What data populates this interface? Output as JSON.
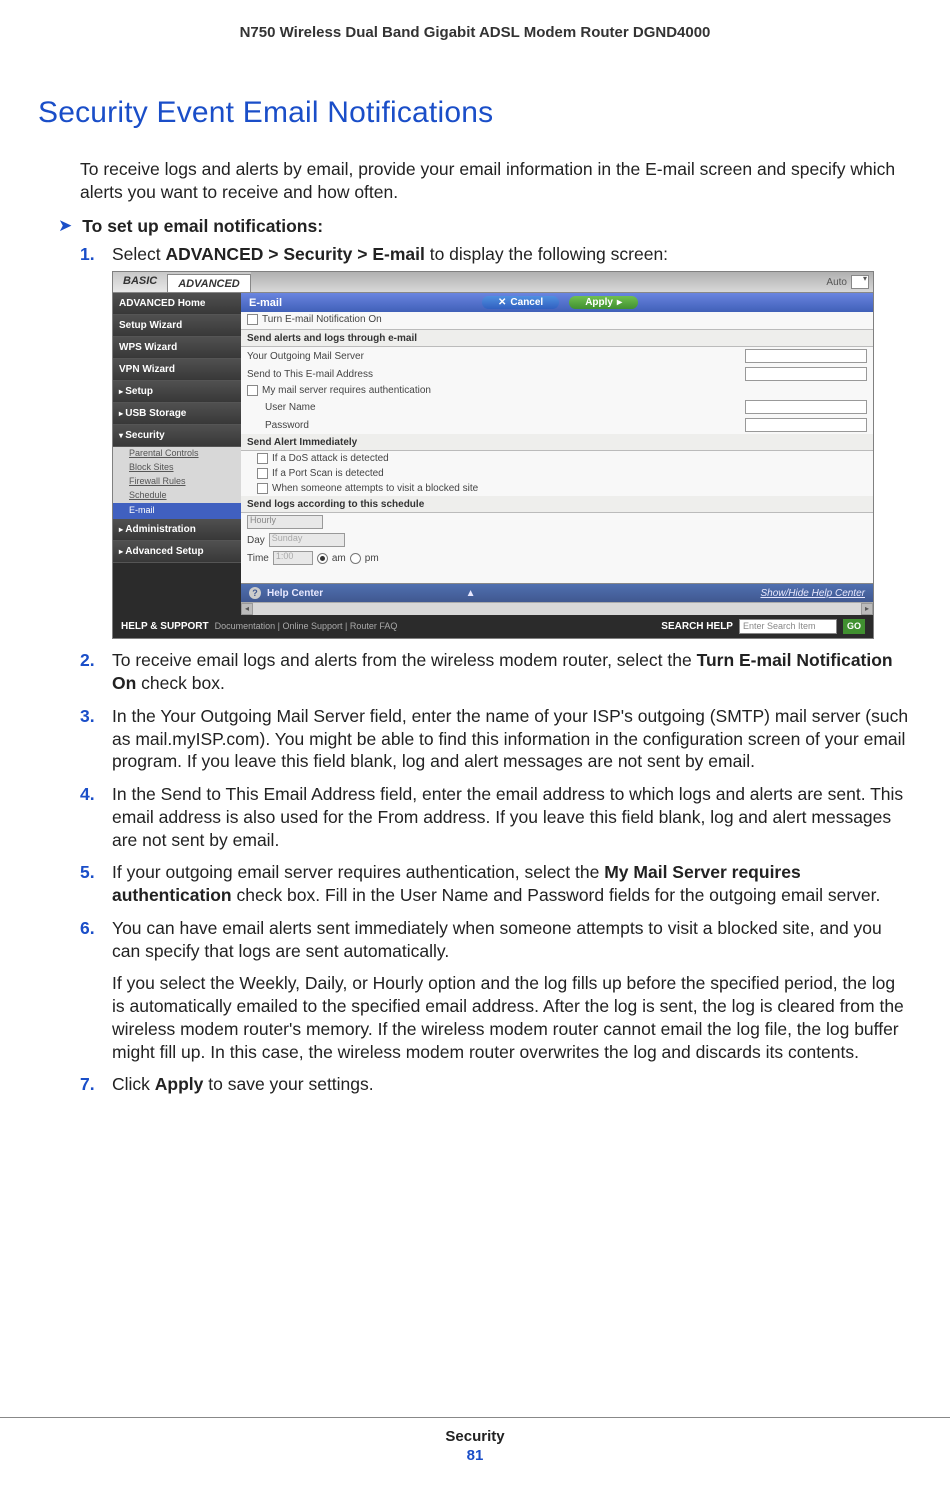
{
  "header": {
    "product": "N750 Wireless Dual Band Gigabit ADSL Modem Router DGND4000"
  },
  "title": "Security Event Email Notifications",
  "intro": "To receive logs and alerts by email, provide your email information in the E-mail screen and specify which alerts you want to receive and how often.",
  "subhead": "To set up email notifications:",
  "steps": {
    "s1_pre": "Select ",
    "s1_bold": "ADVANCED > Security > E-mail",
    "s1_post": " to display the following screen:",
    "s2_pre": "To receive email logs and alerts from the wireless modem router, select the ",
    "s2_bold": "Turn E-mail Notification On",
    "s2_post": " check box.",
    "s3": "In the Your Outgoing Mail Server field, enter the name of your ISP's outgoing (SMTP) mail server (such as mail.myISP.com). You might be able to find this information in the configuration screen of your email program. If you leave this field blank, log and alert messages are not sent by email.",
    "s4": "In the Send to This Email Address field, enter the email address to which logs and alerts are sent. This email address is also used for the From address. If you leave this field blank, log and alert messages are not sent by email.",
    "s5_pre": "If your outgoing email server requires authentication, select the ",
    "s5_bold": "My Mail Server requires authentication",
    "s5_post": " check box. Fill in the User Name and Password fields for the outgoing email server.",
    "s6a": "You can have email alerts sent immediately when someone attempts to visit a blocked site, and you can specify that logs are sent automatically.",
    "s6b": "If you select the Weekly, Daily, or Hourly option and the log fills up before the specified period, the log is automatically emailed to the specified email address. After the log is sent, the log is cleared from the wireless modem router's memory. If the wireless modem router cannot email the log file, the log buffer might fill up. In this case, the wireless modem router overwrites the log and discards its contents.",
    "s7_pre": "Click ",
    "s7_bold": "Apply",
    "s7_post": " to save your settings."
  },
  "screenshot": {
    "tabs": {
      "basic": "BASIC",
      "advanced": "ADVANCED"
    },
    "auto": "Auto",
    "sidebar": {
      "home": "ADVANCED Home",
      "setup_wizard": "Setup Wizard",
      "wps_wizard": "WPS Wizard",
      "vpn_wizard": "VPN Wizard",
      "setup": "Setup",
      "usb": "USB Storage",
      "security": "Security",
      "sub": {
        "pc": "Parental Controls",
        "bs": "Block Sites",
        "fr": "Firewall Rules",
        "sc": "Schedule",
        "em": "E-mail"
      },
      "admin": "Administration",
      "adv": "Advanced Setup"
    },
    "panel": {
      "title": "E-mail",
      "cancel": "Cancel",
      "apply": "Apply",
      "turn_on": "Turn E-mail Notification On",
      "sect1": "Send alerts and logs through e-mail",
      "outgoing": "Your Outgoing Mail Server",
      "sendto": "Send to This E-mail Address",
      "auth": "My mail server requires authentication",
      "user": "User Name",
      "pass": "Password",
      "sect2": "Send Alert Immediately",
      "dos": "If a DoS attack is detected",
      "portscan": "If a Port Scan is detected",
      "blocked": "When someone attempts to visit a blocked site",
      "sect3": "Send logs according to this schedule",
      "sched": "Hourly",
      "day_lbl": "Day",
      "day_val": "Sunday",
      "time_lbl": "Time",
      "time_val": "1:00",
      "am": "am",
      "pm": "pm",
      "help_center": "Help Center",
      "help_link": "Show/Hide Help Center"
    },
    "footer": {
      "help": "HELP & SUPPORT",
      "links": "Documentation | Online Support | Router FAQ",
      "search": "SEARCH HELP",
      "placeholder": "Enter Search Item",
      "go": "GO"
    }
  },
  "page_footer": {
    "label": "Security",
    "num": "81"
  }
}
